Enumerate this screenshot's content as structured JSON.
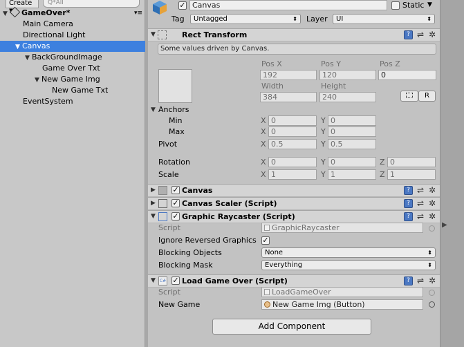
{
  "hierarchy": {
    "create_label": "Create",
    "search_placeholder": "Q*All",
    "scene_name": "GameOver*",
    "items": [
      {
        "label": "Main Camera"
      },
      {
        "label": "Directional Light"
      },
      {
        "label": "Canvas"
      },
      {
        "label": "BackGroundImage"
      },
      {
        "label": "Game Over Txt"
      },
      {
        "label": "New Game Img"
      },
      {
        "label": "New Game Txt"
      },
      {
        "label": "EventSystem"
      }
    ]
  },
  "inspector": {
    "object_name": "Canvas",
    "static_label": "Static",
    "tag_label": "Tag",
    "tag_value": "Untagged",
    "layer_label": "Layer",
    "layer_value": "UI",
    "rect_transform": {
      "title": "Rect Transform",
      "note": "Some values driven by Canvas.",
      "pos_x_label": "Pos X",
      "pos_y_label": "Pos Y",
      "pos_z_label": "Pos Z",
      "pos_x": "192",
      "pos_y": "120",
      "pos_z": "0",
      "width_label": "Width",
      "height_label": "Height",
      "width": "384",
      "height": "240",
      "r_button": "R",
      "anchors_label": "Anchors",
      "min_label": "Min",
      "max_label": "Max",
      "min_x": "0",
      "min_y": "0",
      "max_x": "0",
      "max_y": "0",
      "pivot_label": "Pivot",
      "pivot_x": "0.5",
      "pivot_y": "0.5",
      "rotation_label": "Rotation",
      "rot_x": "0",
      "rot_y": "0",
      "rot_z": "0",
      "scale_label": "Scale",
      "scale_x": "1",
      "scale_y": "1",
      "scale_z": "1",
      "axis_x": "X",
      "axis_y": "Y",
      "axis_z": "Z"
    },
    "canvas": {
      "title": "Canvas"
    },
    "canvas_scaler": {
      "title": "Canvas Scaler (Script)"
    },
    "graphic_raycaster": {
      "title": "Graphic Raycaster (Script)",
      "script_label": "Script",
      "script_value": "GraphicRaycaster",
      "ignore_label": "Ignore Reversed Graphics",
      "blocking_objects_label": "Blocking Objects",
      "blocking_objects_value": "None",
      "blocking_mask_label": "Blocking Mask",
      "blocking_mask_value": "Everything"
    },
    "load_game_over": {
      "title": "Load Game Over (Script)",
      "script_label": "Script",
      "script_value": "LoadGameOver",
      "new_game_label": "New Game",
      "new_game_value": "New Game Img (Button)"
    },
    "add_component": "Add Component"
  },
  "colors": {
    "selection": "#3d80df",
    "help_icon": "#4b78c3"
  }
}
